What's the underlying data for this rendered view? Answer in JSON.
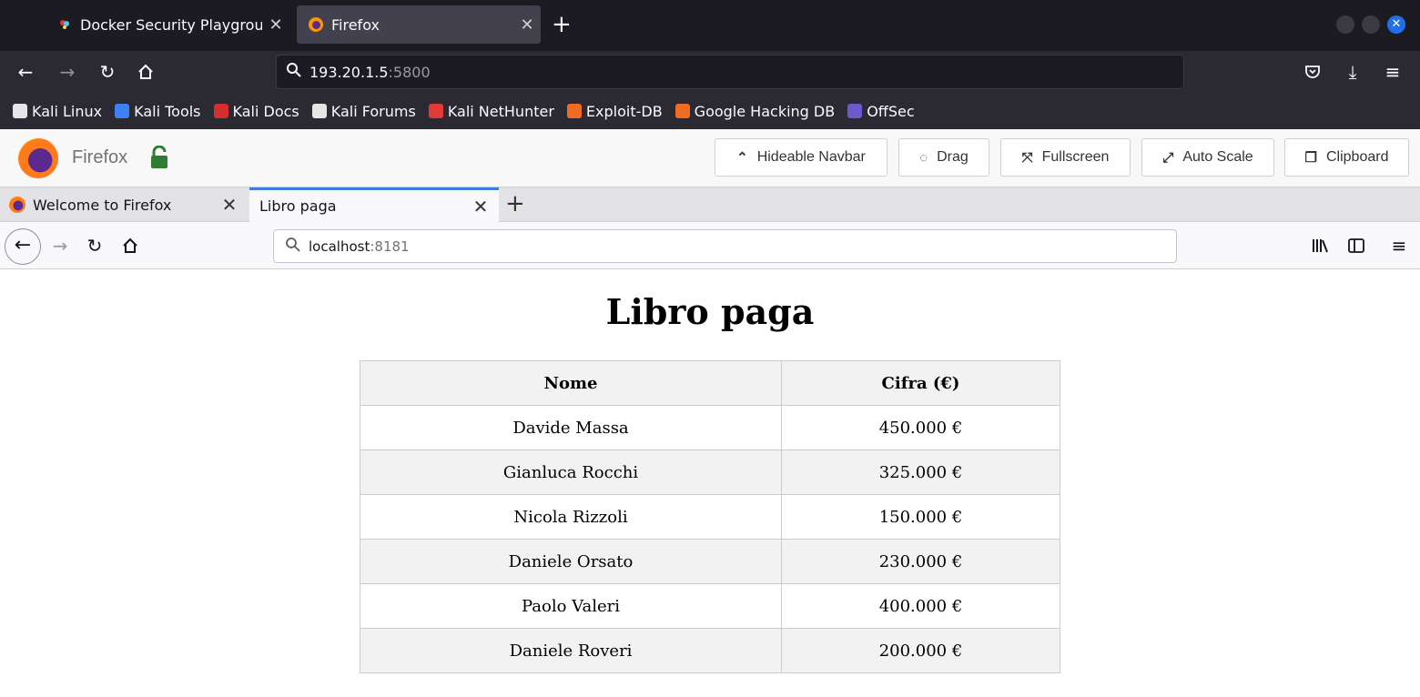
{
  "outer_browser": {
    "tabs": [
      {
        "title": "Docker Security Playground",
        "active": false
      },
      {
        "title": "Firefox",
        "active": true
      }
    ],
    "url_host": "193.20.1.5",
    "url_port": ":5800",
    "bookmarks": [
      {
        "label": "Kali Linux",
        "color": "#e6e6e6"
      },
      {
        "label": "Kali Tools",
        "color": "#3b82f6"
      },
      {
        "label": "Kali Docs",
        "color": "#d32f2f"
      },
      {
        "label": "Kali Forums",
        "color": "#e6e6e6"
      },
      {
        "label": "Kali NetHunter",
        "color": "#e53935"
      },
      {
        "label": "Exploit-DB",
        "color": "#f26b22"
      },
      {
        "label": "Google Hacking DB",
        "color": "#f26b22"
      },
      {
        "label": "OffSec",
        "color": "#6a5acd"
      }
    ]
  },
  "vnc_toolbar": {
    "app_name": "Firefox",
    "buttons": {
      "hideable_navbar": "Hideable Navbar",
      "drag": "Drag",
      "fullscreen": "Fullscreen",
      "auto_scale": "Auto Scale",
      "clipboard": "Clipboard"
    }
  },
  "inner_browser": {
    "tabs": [
      {
        "title": "Welcome to Firefox",
        "active": false
      },
      {
        "title": "Libro paga",
        "active": true
      }
    ],
    "url_host": "localhost",
    "url_port": ":8181"
  },
  "page": {
    "title": "Libro paga",
    "table": {
      "headers": [
        "Nome",
        "Cifra (€)"
      ],
      "rows": [
        [
          "Davide Massa",
          "450.000 €"
        ],
        [
          "Gianluca Rocchi",
          "325.000 €"
        ],
        [
          "Nicola Rizzoli",
          "150.000 €"
        ],
        [
          "Daniele Orsato",
          "230.000 €"
        ],
        [
          "Paolo Valeri",
          "400.000 €"
        ],
        [
          "Daniele Roveri",
          "200.000 €"
        ]
      ]
    }
  }
}
